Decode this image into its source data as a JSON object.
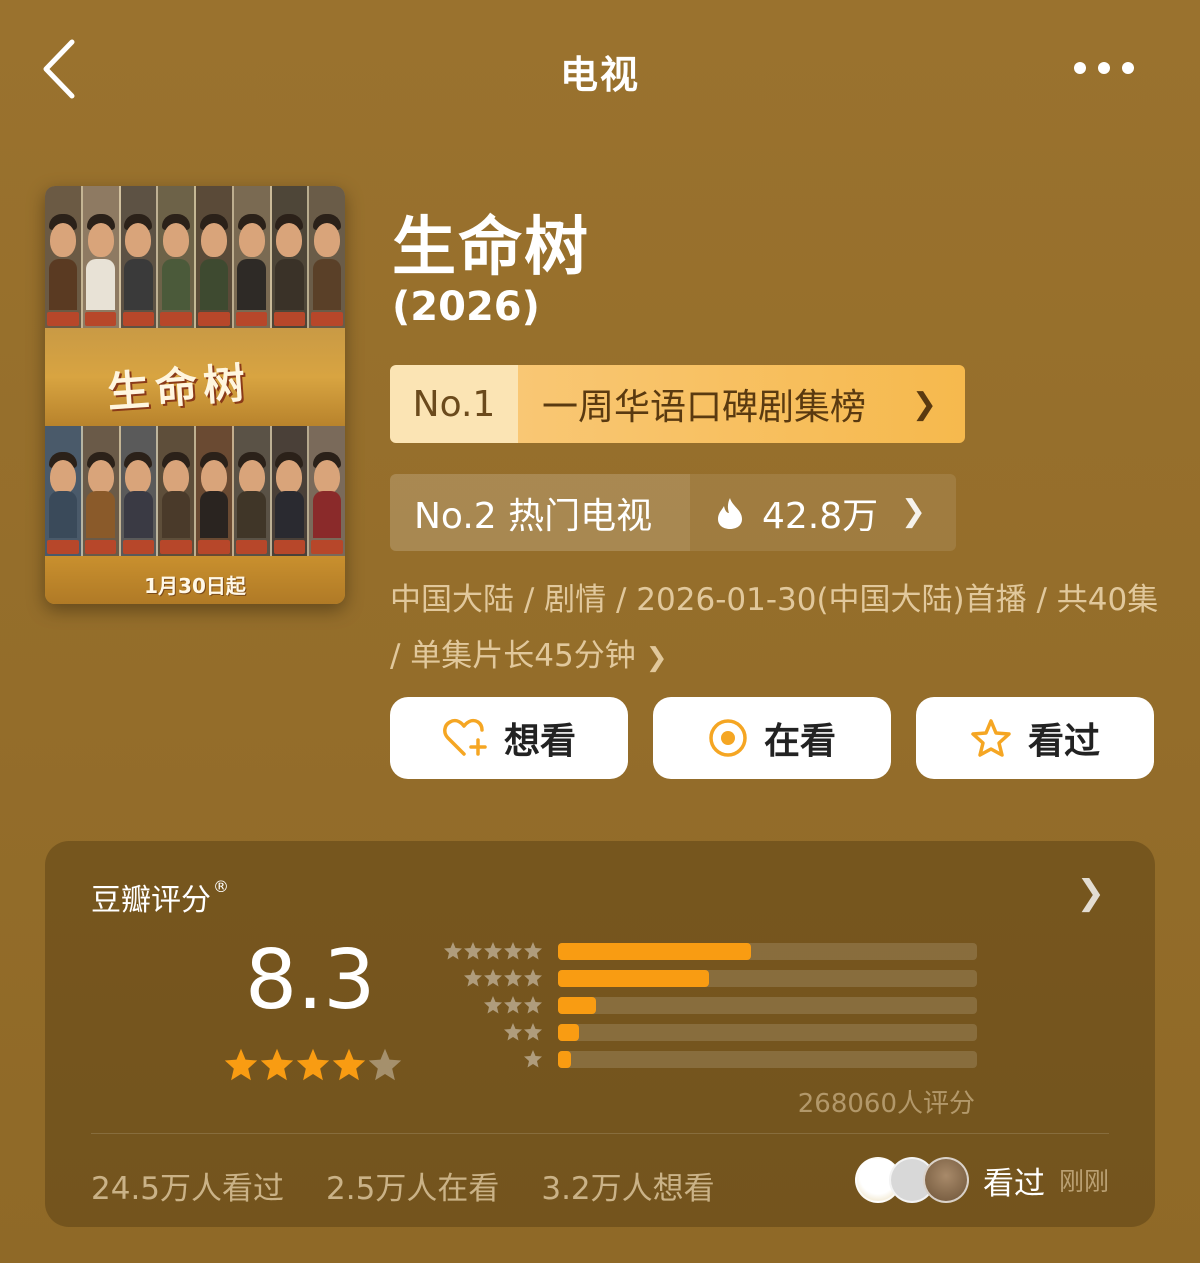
{
  "header": {
    "title": "电视"
  },
  "poster": {
    "title_art": "生命树",
    "date_text": "1月30日起"
  },
  "show": {
    "title": "生命树",
    "year": "(2026)"
  },
  "rank1": {
    "number": "No.1",
    "label": "一周华语口碑剧集榜"
  },
  "rank2": {
    "number": "No.2 热门电视",
    "hot_value": "42.8万"
  },
  "meta": {
    "text": "中国大陆 / 剧情 / 2026-01-30(中国大陆)首播 / 共40集 / 单集片长45分钟"
  },
  "actions": {
    "want": "想看",
    "watching": "在看",
    "watched": "看过"
  },
  "rating": {
    "title": "豆瓣评分",
    "registered_mark": "®",
    "score": "8.3",
    "stars_filled": 4,
    "stars_total": 5,
    "distribution": [
      {
        "stars": 5,
        "fraction": 0.46
      },
      {
        "stars": 4,
        "fraction": 0.36
      },
      {
        "stars": 3,
        "fraction": 0.09
      },
      {
        "stars": 2,
        "fraction": 0.05
      },
      {
        "stars": 1,
        "fraction": 0.03
      }
    ],
    "count_text": "268060人评分",
    "stats": {
      "watched": "24.5万人看过",
      "watching": "2.5万人在看",
      "want": "3.2万人想看"
    },
    "friend_status": "看过",
    "friend_time": "刚刚"
  },
  "colors": {
    "background": "#98702c",
    "accent": "#f99c12",
    "rank1_bg": "#f6b94d",
    "button_bg": "#ffffff",
    "icon_orange": "#f5a623"
  },
  "icons": {
    "back": "chevron-left-icon",
    "more": "more-dots-icon",
    "hot": "flame-icon",
    "want": "heart-plus-icon",
    "watching": "target-circle-icon",
    "watched": "star-outline-icon"
  }
}
